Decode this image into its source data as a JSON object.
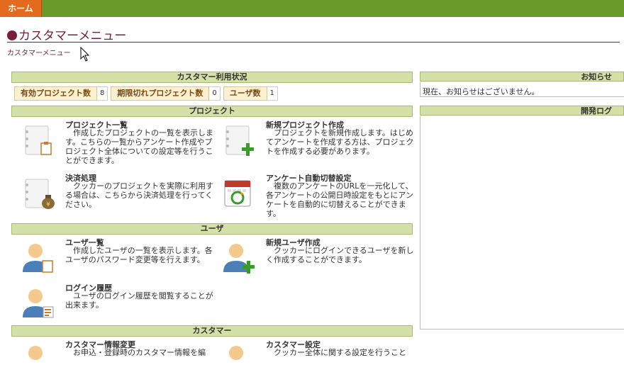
{
  "nav": {
    "home_label": "ホーム"
  },
  "page": {
    "title": "カスタマーメニュー",
    "breadcrumb": "カスタマーメニュー"
  },
  "usage": {
    "header": "カスタマー利用状況",
    "stats": [
      {
        "label": "有効プロジェクト数",
        "value": "8"
      },
      {
        "label": "期限切れプロジェクト数",
        "value": "0"
      },
      {
        "label": "ユーザ数",
        "value": "1"
      }
    ]
  },
  "project": {
    "header": "プロジェクト",
    "items": [
      {
        "name": "プロジェクト一覧",
        "desc": "作成したプロジェクトの一覧を表示します。こちらの一覧からアンケート作成やプロジェクト全体についての設定等を行うことができます。"
      },
      {
        "name": "新規プロジェクト作成",
        "desc": "プロジェクトを新規作成します。はじめてアンケートを作成する方は、プロジェクトを作成する必要があります。"
      },
      {
        "name": "決済処理",
        "desc": "クッカーのプロジェクトを実際に利用する場合は、こちらから決済処理を行ってください。"
      },
      {
        "name": "アンケート自動切替設定",
        "desc": "複数のアンケートのURLを一元化して、各アンケートの公開日時設定をもとにアンケートを自動的に切替えることができます。"
      }
    ]
  },
  "user": {
    "header": "ユーザ",
    "items": [
      {
        "name": "ユーザ一覧",
        "desc": "作成したユーザの一覧を表示します。各ユーザのパスワード変更等を行えます。"
      },
      {
        "name": "新規ユーザ作成",
        "desc": "クッカーにログインできるユーザを新しく作成することができます。"
      },
      {
        "name": "ログイン履歴",
        "desc": "ユーザのログイン履歴を閲覧することが出来ます。"
      }
    ]
  },
  "customer": {
    "header": "カスタマー",
    "items": [
      {
        "name": "カスタマー情報変更",
        "desc": "お申込・登録時のカスタマー情報を編"
      },
      {
        "name": "カスタマー設定",
        "desc": "クッカー全体に関する設定を行うこと"
      }
    ]
  },
  "notice": {
    "header": "お知らせ",
    "text": "現在、お知らせはございません。"
  },
  "devlog": {
    "header": "開発ログ"
  },
  "colors": {
    "accent": "#7a1c3a",
    "nav_green": "#6a9a2a",
    "home_orange": "#e46a1d",
    "section_bar": "#d3e0a8"
  }
}
